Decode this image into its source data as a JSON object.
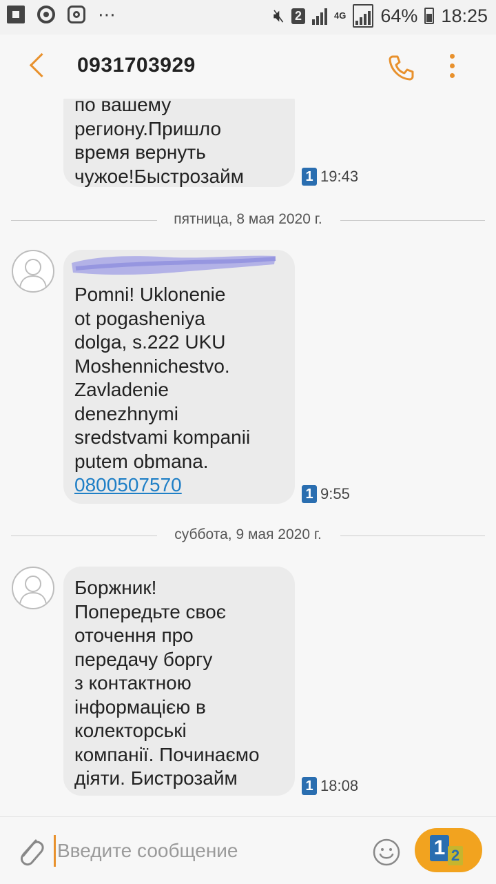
{
  "status_bar": {
    "notification_icons": [
      "flipboard-icon",
      "chrome-icon",
      "instagram-icon",
      "more-notifications-icon"
    ],
    "sim_badge": "2",
    "network": "4G",
    "battery": "64%",
    "time": "18:25"
  },
  "header": {
    "title": "0931703929",
    "icons": [
      "back-arrow-icon",
      "phone-icon",
      "more-vertical-icon"
    ]
  },
  "messages": [
    {
      "lines": [
        "по вашему",
        "региону.Пришло",
        "время вернуть",
        "чужое!Быстрозайм"
      ],
      "sim": "1",
      "time": "19:43"
    },
    {
      "date_separator": "пятница, 8 мая 2020 г.",
      "lines": [
        "Pomni! Uklonenie",
        "ot pogasheniya",
        "dolga, s.222 UKU",
        "Moshennichestvo.",
        "Zavladenie",
        "denezhnymi",
        "sredstvami kompanii",
        "putem obmana."
      ],
      "link": "0800507570",
      "sim": "1",
      "time": "9:55"
    },
    {
      "date_separator": "суббота, 9 мая 2020 г.",
      "lines": [
        "Боржник!",
        "Попередьте своє",
        "оточення про",
        "передачу боргу",
        "з контактною",
        "інформацією в",
        "колекторські",
        "компанії. Починаємо",
        "діяти. Бистрозайм"
      ],
      "sim": "1",
      "time": "18:08"
    }
  ],
  "composer": {
    "placeholder": "Введите сообщение",
    "send_sim_primary": "1",
    "send_sim_secondary": "2"
  },
  "colors": {
    "accent": "#e8912d",
    "send_button": "#f2a31f",
    "bubble": "#ebebeb",
    "link": "#1f7fc6",
    "sim_badge": "#2a6eb0"
  }
}
